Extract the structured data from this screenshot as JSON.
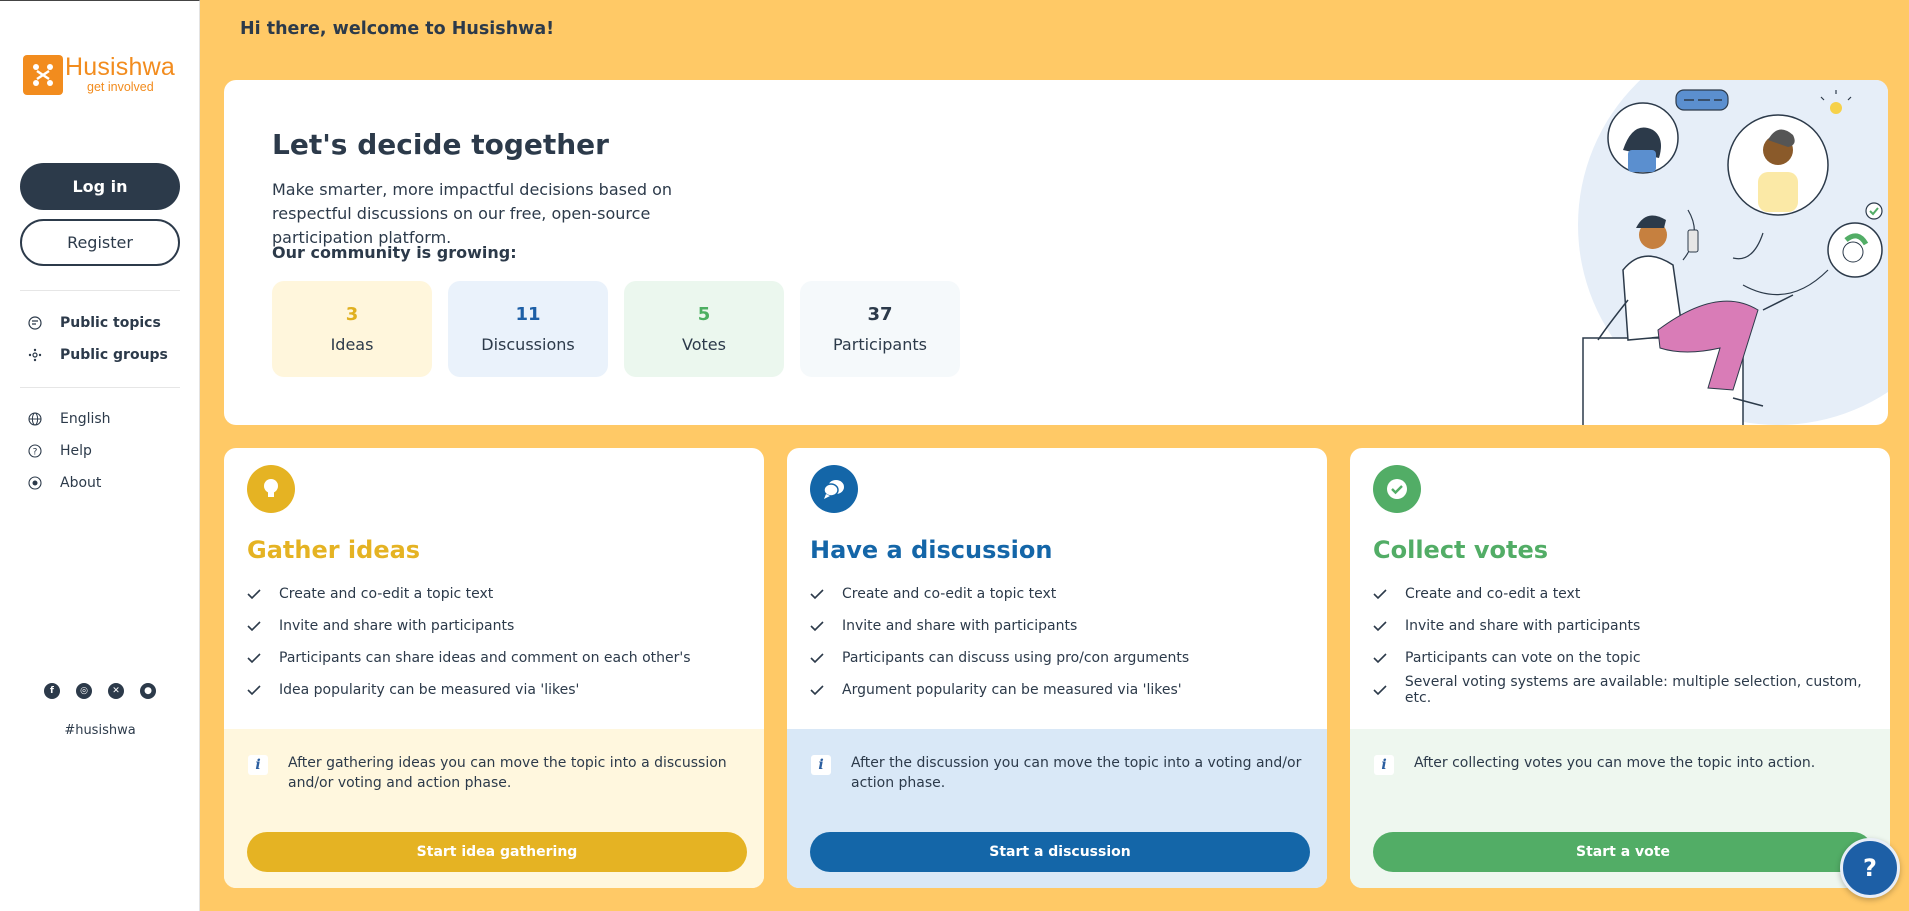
{
  "sidebar": {
    "logo_name": "Husishwa",
    "logo_tagline": "get involved",
    "login_label": "Log in",
    "register_label": "Register",
    "nav_primary": [
      {
        "label": "Public topics",
        "icon": "topics-icon"
      },
      {
        "label": "Public groups",
        "icon": "groups-icon"
      }
    ],
    "nav_secondary": [
      {
        "label": "English",
        "icon": "globe-icon"
      },
      {
        "label": "Help",
        "icon": "help-icon"
      },
      {
        "label": "About",
        "icon": "about-icon"
      }
    ],
    "social": [
      {
        "name": "facebook-icon",
        "glyph": "f"
      },
      {
        "name": "instagram-icon",
        "glyph": "◎"
      },
      {
        "name": "x-icon",
        "glyph": "✕"
      },
      {
        "name": "github-icon",
        "glyph": "●"
      }
    ],
    "hashtag": "#husishwa"
  },
  "greeting": "Hi there, welcome to Husishwa!",
  "hero": {
    "title": "Let's decide together",
    "lead": "Make smarter, more impactful decisions based on respectful discussions on our free, open-source participation platform.",
    "community_label": "Our community is growing:",
    "stats": [
      {
        "value": "3",
        "label": "Ideas",
        "color": "#e0b020",
        "bg": "#fff6dc"
      },
      {
        "value": "11",
        "label": "Discussions",
        "color": "#1d5fa6",
        "bg": "#eaf2fb"
      },
      {
        "value": "5",
        "label": "Votes",
        "color": "#4caf61",
        "bg": "#ebf7ee"
      },
      {
        "value": "37",
        "label": "Participants",
        "color": "#2c3a4a",
        "bg": "#f5f9fb"
      }
    ]
  },
  "cards": [
    {
      "title": "Gather ideas",
      "accent": "#e5b323",
      "note_bg": "#fff7de",
      "icon": "lightbulb-icon",
      "items": [
        "Create and co-edit a topic text",
        "Invite and share with participants",
        "Participants can share ideas and comment on each other's",
        "Idea popularity can be measured via 'likes'"
      ],
      "note": "After gathering ideas you can move the topic into a discussion and/or voting and action phase.",
      "cta": "Start idea gathering"
    },
    {
      "title": "Have a discussion",
      "accent": "#1466a8",
      "note_bg": "#d9e8f7",
      "icon": "speech-bubbles-icon",
      "items": [
        "Create and co-edit a topic text",
        "Invite and share with participants",
        "Participants can discuss using pro/con arguments",
        "Argument popularity can be measured via 'likes'"
      ],
      "note": "After the discussion you can move the topic into a voting and/or action phase.",
      "cta": "Start a discussion"
    },
    {
      "title": "Collect votes",
      "accent": "#52ad66",
      "note_bg": "#eef7ef",
      "icon": "check-circle-icon",
      "items": [
        "Create and co-edit a text",
        "Invite and share with participants",
        "Participants can vote on the topic",
        "Several voting systems are available: multiple selection, custom, etc."
      ],
      "note": "After collecting votes you can move the topic into action.",
      "cta": "Start a vote"
    }
  ],
  "help_fab": "?"
}
